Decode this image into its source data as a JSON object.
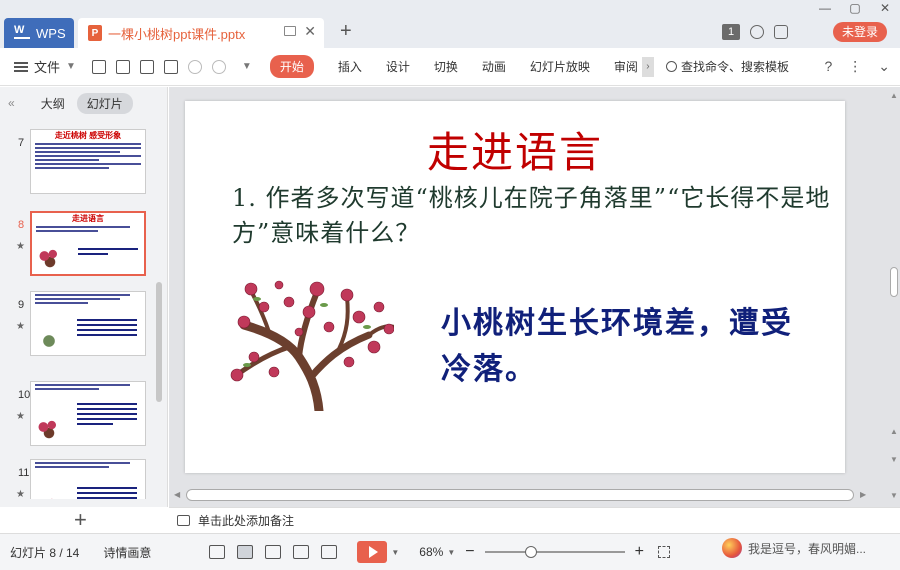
{
  "titlebar": {
    "app_tab": "WPS",
    "doc_tab": "一棵小桃树ppt课件.pptx",
    "badge": "1",
    "login": "未登录"
  },
  "ribbon": {
    "file_menu": "文件",
    "tabs": [
      "开始",
      "插入",
      "设计",
      "切换",
      "动画",
      "幻灯片放映",
      "审阅"
    ],
    "search": "查找命令、搜索模板"
  },
  "leftpanel": {
    "outline": "大纲",
    "slides": "幻灯片",
    "thumbs": [
      {
        "num": "7",
        "title": "走近桃树   感受形象"
      },
      {
        "num": "8",
        "title": "走进语言"
      },
      {
        "num": "9",
        "title": ""
      },
      {
        "num": "10",
        "title": ""
      },
      {
        "num": "11",
        "title": ""
      }
    ]
  },
  "slide": {
    "title": "走进语言",
    "question": "1. 作者多次写道“桃核儿在院子角落里”“它长得不是地方”意味着什么？",
    "answer": "小桃树生长环境差，遭受冷落。"
  },
  "notes": {
    "placeholder": "单击此处添加备注"
  },
  "statusbar": {
    "slide_info": "幻灯片 8 / 14",
    "theme": "诗情画意",
    "zoom": "68%",
    "watermark_text": "我是逗号，春风明媚..."
  },
  "colors": {
    "accent": "#e8614d",
    "wps_blue": "#3f6dba",
    "title_red": "#c00000",
    "answer_blue": "#10207a"
  }
}
